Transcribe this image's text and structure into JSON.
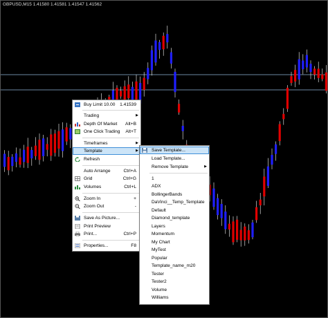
{
  "chart": {
    "title": "GBPUSD,M15  1.41580 1.41581 1.41547 1.41562",
    "colors": {
      "background": "#000000",
      "bull": "#1f1fff",
      "bear": "#e00000",
      "wick": "#ffffff",
      "level_line": "#8fb7d8"
    }
  },
  "context_menu": {
    "items": [
      {
        "label": "Buy Limit 10.00",
        "shortcut": "1.41539",
        "icon": "buy-limit-icon"
      },
      {
        "label": "Trading",
        "submenu": true
      },
      {
        "label": "Depth Of Market",
        "shortcut": "Alt+B",
        "icon": "depth-of-market-icon"
      },
      {
        "label": "One Click Trading",
        "shortcut": "Alt+T",
        "icon": "one-click-trading-icon"
      },
      {
        "label": "Timeframes",
        "submenu": true
      },
      {
        "label": "Template",
        "submenu": true,
        "highlighted": true
      },
      {
        "label": "Refresh",
        "icon": "refresh-icon"
      },
      {
        "label": "Auto Arrange",
        "shortcut": "Ctrl+A"
      },
      {
        "label": "Grid",
        "shortcut": "Ctrl+G",
        "icon": "grid-icon"
      },
      {
        "label": "Volumes",
        "shortcut": "Ctrl+L",
        "icon": "volumes-icon"
      },
      {
        "label": "Zoom In",
        "shortcut": "+",
        "icon": "zoom-in-icon"
      },
      {
        "label": "Zoom Out",
        "shortcut": "-",
        "icon": "zoom-out-icon"
      },
      {
        "label": "Save As Picture...",
        "icon": "save-picture-icon"
      },
      {
        "label": "Print Preview",
        "icon": "print-preview-icon"
      },
      {
        "label": "Print...",
        "shortcut": "Ctrl+P",
        "icon": "print-icon"
      },
      {
        "label": "Properties...",
        "shortcut": "F8",
        "icon": "properties-icon"
      }
    ]
  },
  "template_menu": {
    "items": [
      {
        "label": "Save Template...",
        "icon": "save-template-icon",
        "highlighted": true
      },
      {
        "label": "Load Template..."
      },
      {
        "label": "Remove Template",
        "submenu": true
      },
      {
        "label": "1"
      },
      {
        "label": "ADX"
      },
      {
        "label": "BollingerBands"
      },
      {
        "label": "DaVinci__Temp_Template"
      },
      {
        "label": "Default"
      },
      {
        "label": "Diamond_template"
      },
      {
        "label": "Layers"
      },
      {
        "label": "Momentum"
      },
      {
        "label": "My Chart"
      },
      {
        "label": "MyTest"
      },
      {
        "label": "Popular"
      },
      {
        "label": "Template_name_m20"
      },
      {
        "label": "Tester"
      },
      {
        "label": "Tester2"
      },
      {
        "label": "Volume"
      },
      {
        "label": "Williams"
      }
    ]
  }
}
